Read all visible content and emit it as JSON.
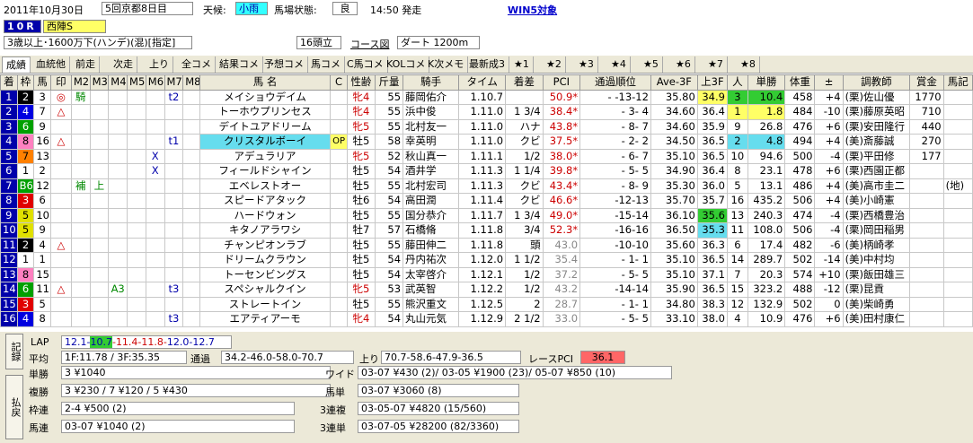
{
  "header": {
    "date": "2011年10月30日",
    "meeting": "5回京都8日目",
    "weather_label": "天候:",
    "weather": "小雨",
    "track_label": "馬場状態:",
    "track": "良",
    "start_time": "14:50 発走",
    "win5": "WIN5対象",
    "race_no": "10R",
    "race_name": "西陣S",
    "conditions": "3歳以上･1600万下(ハンデ)(混)[指定]",
    "runners": "16頭立",
    "course_btn": "コース図",
    "course": "ダート 1200m"
  },
  "tabs": [
    "成績",
    "血統他",
    "前走",
    "次走",
    "上り",
    "全コメ",
    "結果コメ",
    "予想コメ",
    "馬コメ",
    "C馬コメ",
    "KOLコメ",
    "K次メモ",
    "最新成3",
    "★1",
    "★2",
    "★3",
    "★4",
    "★5",
    "★6",
    "★7",
    "★8"
  ],
  "columns": [
    "着",
    "枠",
    "馬",
    "印",
    "M2",
    "M3",
    "M4",
    "M5",
    "M6",
    "M7",
    "M8",
    "馬 名",
    "C",
    "性齢",
    "斤量",
    "騎手",
    "タイム",
    "着差",
    "PCI",
    "通過順位",
    "Ave-3F",
    "上3F",
    "人",
    "単勝",
    "体重",
    "±",
    "調教師",
    "賞金",
    "馬記"
  ],
  "rows": [
    [
      "1",
      "2",
      "3",
      "◎",
      "騎",
      "",
      "",
      "",
      "",
      "t2",
      "",
      "メイショウデイム",
      "",
      "牝4",
      "55",
      "藤岡佑介",
      "1.10.7",
      "",
      "50.9*",
      "- -13-12",
      "35.80",
      "34.9",
      "3",
      "10.4",
      "458",
      "+4",
      "(栗)佐山優",
      "1770",
      ""
    ],
    [
      "2",
      "4",
      "7",
      "△",
      "",
      "",
      "",
      "",
      "",
      "",
      "",
      "トーホウプリンセス",
      "",
      "牝4",
      "55",
      "浜中俊",
      "1.11.0",
      "1 3/4",
      "38.4*",
      "- 3- 4",
      "34.60",
      "36.4",
      "1",
      "1.8",
      "484",
      "-10",
      "(栗)藤原英昭",
      "710",
      ""
    ],
    [
      "3",
      "6",
      "9",
      "",
      "",
      "",
      "",
      "",
      "",
      "",
      "",
      "デイトユアドリーム",
      "",
      "牝5",
      "55",
      "北村友一",
      "1.11.0",
      "ハナ",
      "43.8*",
      "- 8- 7",
      "34.60",
      "35.9",
      "9",
      "26.8",
      "476",
      "+6",
      "(栗)安田隆行",
      "440",
      ""
    ],
    [
      "4",
      "8",
      "16",
      "△",
      "",
      "",
      "",
      "",
      "",
      "t1",
      "",
      "クリスタルボーイ",
      "OP",
      "牡5",
      "58",
      "幸英明",
      "1.11.0",
      "クビ",
      "37.5*",
      "- 2- 2",
      "34.50",
      "36.5",
      "2",
      "4.8",
      "494",
      "+4",
      "(美)斎藤誠",
      "270",
      ""
    ],
    [
      "5",
      "7",
      "13",
      "",
      "",
      "",
      "",
      "",
      "X",
      "",
      "",
      "アデュラリア",
      "",
      "牝5",
      "52",
      "秋山真一",
      "1.11.1",
      "1/2",
      "38.0*",
      "- 6- 7",
      "35.10",
      "36.5",
      "10",
      "94.6",
      "500",
      "-4",
      "(栗)平田修",
      "177",
      ""
    ],
    [
      "6",
      "1",
      "2",
      "",
      "",
      "",
      "",
      "",
      "X",
      "",
      "",
      "フィールドシャイン",
      "",
      "牡5",
      "54",
      "酒井学",
      "1.11.3",
      "1 1/4",
      "39.8*",
      "- 5- 5",
      "34.90",
      "36.4",
      "8",
      "23.1",
      "478",
      "+6",
      "(栗)西園正都",
      "",
      ""
    ],
    [
      "7",
      "B6",
      "12",
      "",
      "補",
      "上",
      "",
      "",
      "",
      "",
      "",
      "エベレストオー",
      "",
      "牡5",
      "55",
      "北村宏司",
      "1.11.3",
      "クビ",
      "43.4*",
      "- 8- 9",
      "35.30",
      "36.0",
      "5",
      "13.1",
      "486",
      "+4",
      "(美)高市圭二",
      "",
      "(地)"
    ],
    [
      "8",
      "3",
      "6",
      "",
      "",
      "",
      "",
      "",
      "",
      "",
      "",
      "スピードアタック",
      "",
      "牡6",
      "54",
      "高田潤",
      "1.11.4",
      "クビ",
      "46.6*",
      "-12-13",
      "35.70",
      "35.7",
      "16",
      "435.2",
      "506",
      "+4",
      "(美)小崎憲",
      "",
      ""
    ],
    [
      "9",
      "5",
      "10",
      "",
      "",
      "",
      "",
      "",
      "",
      "",
      "",
      "ハードウォン",
      "",
      "牡5",
      "55",
      "国分恭介",
      "1.11.7",
      "1 3/4",
      "49.0*",
      "-15-14",
      "36.10",
      "35.6",
      "13",
      "240.3",
      "474",
      "-4",
      "(栗)西橋豊治",
      "",
      ""
    ],
    [
      "10",
      "5",
      "9",
      "",
      "",
      "",
      "",
      "",
      "",
      "",
      "",
      "キタノアラワシ",
      "",
      "牡7",
      "57",
      "石橋脩",
      "1.11.8",
      "3/4",
      "52.3*",
      "-16-16",
      "36.50",
      "35.3",
      "11",
      "108.0",
      "506",
      "-4",
      "(栗)岡田稲男",
      "",
      ""
    ],
    [
      "11",
      "2",
      "4",
      "△",
      "",
      "",
      "",
      "",
      "",
      "",
      "",
      "チャンピオンラブ",
      "",
      "牡5",
      "55",
      "藤田伸二",
      "1.11.8",
      "頭",
      "43.0",
      "-10-10",
      "35.60",
      "36.3",
      "6",
      "17.4",
      "482",
      "-6",
      "(美)柄崎孝",
      "",
      ""
    ],
    [
      "12",
      "1",
      "1",
      "",
      "",
      "",
      "",
      "",
      "",
      "",
      "",
      "ドリームクラウン",
      "",
      "牡5",
      "54",
      "丹内祐次",
      "1.12.0",
      "1 1/2",
      "35.4",
      "- 1- 1",
      "35.10",
      "36.5",
      "14",
      "289.7",
      "502",
      "-14",
      "(美)中村均",
      "",
      ""
    ],
    [
      "13",
      "8",
      "15",
      "",
      "",
      "",
      "",
      "",
      "",
      "",
      "",
      "トーセンビングス",
      "",
      "牡5",
      "54",
      "太宰啓介",
      "1.12.1",
      "1/2",
      "37.2",
      "- 5- 5",
      "35.10",
      "37.1",
      "7",
      "20.3",
      "574",
      "+10",
      "(栗)飯田雄三",
      "",
      ""
    ],
    [
      "14",
      "6",
      "11",
      "△",
      "",
      "",
      "A3",
      "",
      "",
      "t3",
      "",
      "スペシャルクイン",
      "",
      "牝5",
      "53",
      "武英智",
      "1.12.2",
      "1/2",
      "43.2",
      "-14-14",
      "35.90",
      "36.5",
      "15",
      "323.2",
      "488",
      "-12",
      "(栗)昆貢",
      "",
      ""
    ],
    [
      "15",
      "3",
      "5",
      "",
      "",
      "",
      "",
      "",
      "",
      "",
      "",
      "ストレートイン",
      "",
      "牡5",
      "55",
      "熊沢重文",
      "1.12.5",
      "2",
      "28.7",
      "- 1- 1",
      "34.80",
      "38.3",
      "12",
      "132.9",
      "502",
      "0",
      "(美)柴崎勇",
      "",
      ""
    ],
    [
      "16",
      "4",
      "8",
      "",
      "",
      "",
      "",
      "",
      "",
      "t3",
      "",
      "エアティアーモ",
      "",
      "牝4",
      "54",
      "丸山元気",
      "1.12.9",
      "2 1/2",
      "33.0",
      "- 5- 5",
      "33.10",
      "38.0",
      "4",
      "10.9",
      "476",
      "+6",
      "(美)田村康仁",
      "",
      ""
    ]
  ],
  "bottom": {
    "label_record": "記録",
    "label_payout": "払戻",
    "lap_label": "LAP",
    "lap_a": "12.1-",
    "lap_b": "10.7",
    "lap_c": "-11.4-11.8-",
    "lap_d": "12.0-12.7",
    "avg_label": "平均",
    "avg": "1F:11.78 / 3F:35.35",
    "pass_label": "通過",
    "pass": "34.2-46.0-58.0-70.7",
    "up_label": "上り",
    "up": "70.7-58.6-47.9-36.5",
    "pci_label": "レースPCI",
    "pci": "36.1",
    "tansho_label": "単勝",
    "tansho": "3 ¥1040",
    "fukusho_label": "複勝",
    "fukusho": "3 ¥230 / 7 ¥120 / 5 ¥430",
    "wakuren_label": "枠連",
    "wakuren": "2-4 ¥500 (2)",
    "umaren_label": "馬連",
    "umaren": "03-07 ¥1040 (2)",
    "wide_label": "ワイド",
    "wide": "03-07 ¥430 (2)/ 03-05 ¥1900 (23)/ 05-07 ¥850 (10)",
    "umatan_label": "馬単",
    "umatan": "03-07 ¥3060 (8)",
    "sanfuku_label": "3連複",
    "sanfuku": "03-05-07 ¥4820 (15/560)",
    "santan_label": "3連単",
    "santan": "03-07-05 ¥28200 (82/3360)"
  },
  "colors": {
    "frame": [
      "#ffffff",
      "#000000",
      "#e00000",
      "#0000e0",
      "#e0e000",
      "#00a000",
      "#ff8000",
      "#ff80c0"
    ],
    "green_hi": "#33cc33",
    "yellow_hi": "#ffff66",
    "cyan_hi": "#66ddee",
    "pci_hi": "#ff6666",
    "win5": "#0000cc"
  }
}
